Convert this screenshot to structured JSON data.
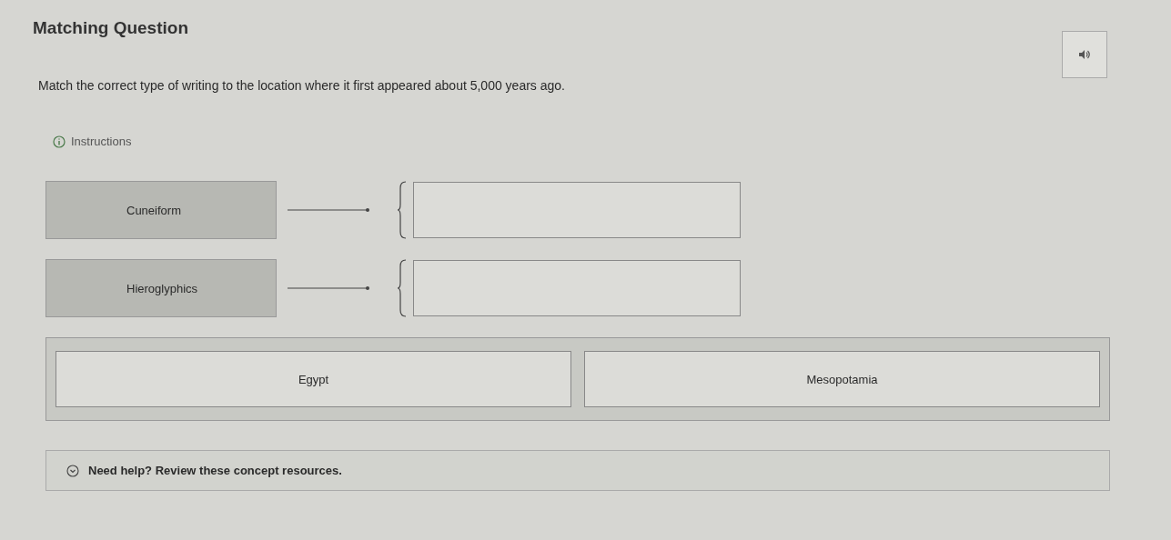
{
  "title": "Matching Question",
  "prompt": "Match the correct type of writing to the location where it first appeared about 5,000 years ago.",
  "instructions": "Instructions",
  "pairs": [
    {
      "term": "Cuneiform"
    },
    {
      "term": "Hieroglyphics"
    }
  ],
  "answers": [
    "Egypt",
    "Mesopotamia"
  ],
  "help": "Need help? Review these concept resources."
}
